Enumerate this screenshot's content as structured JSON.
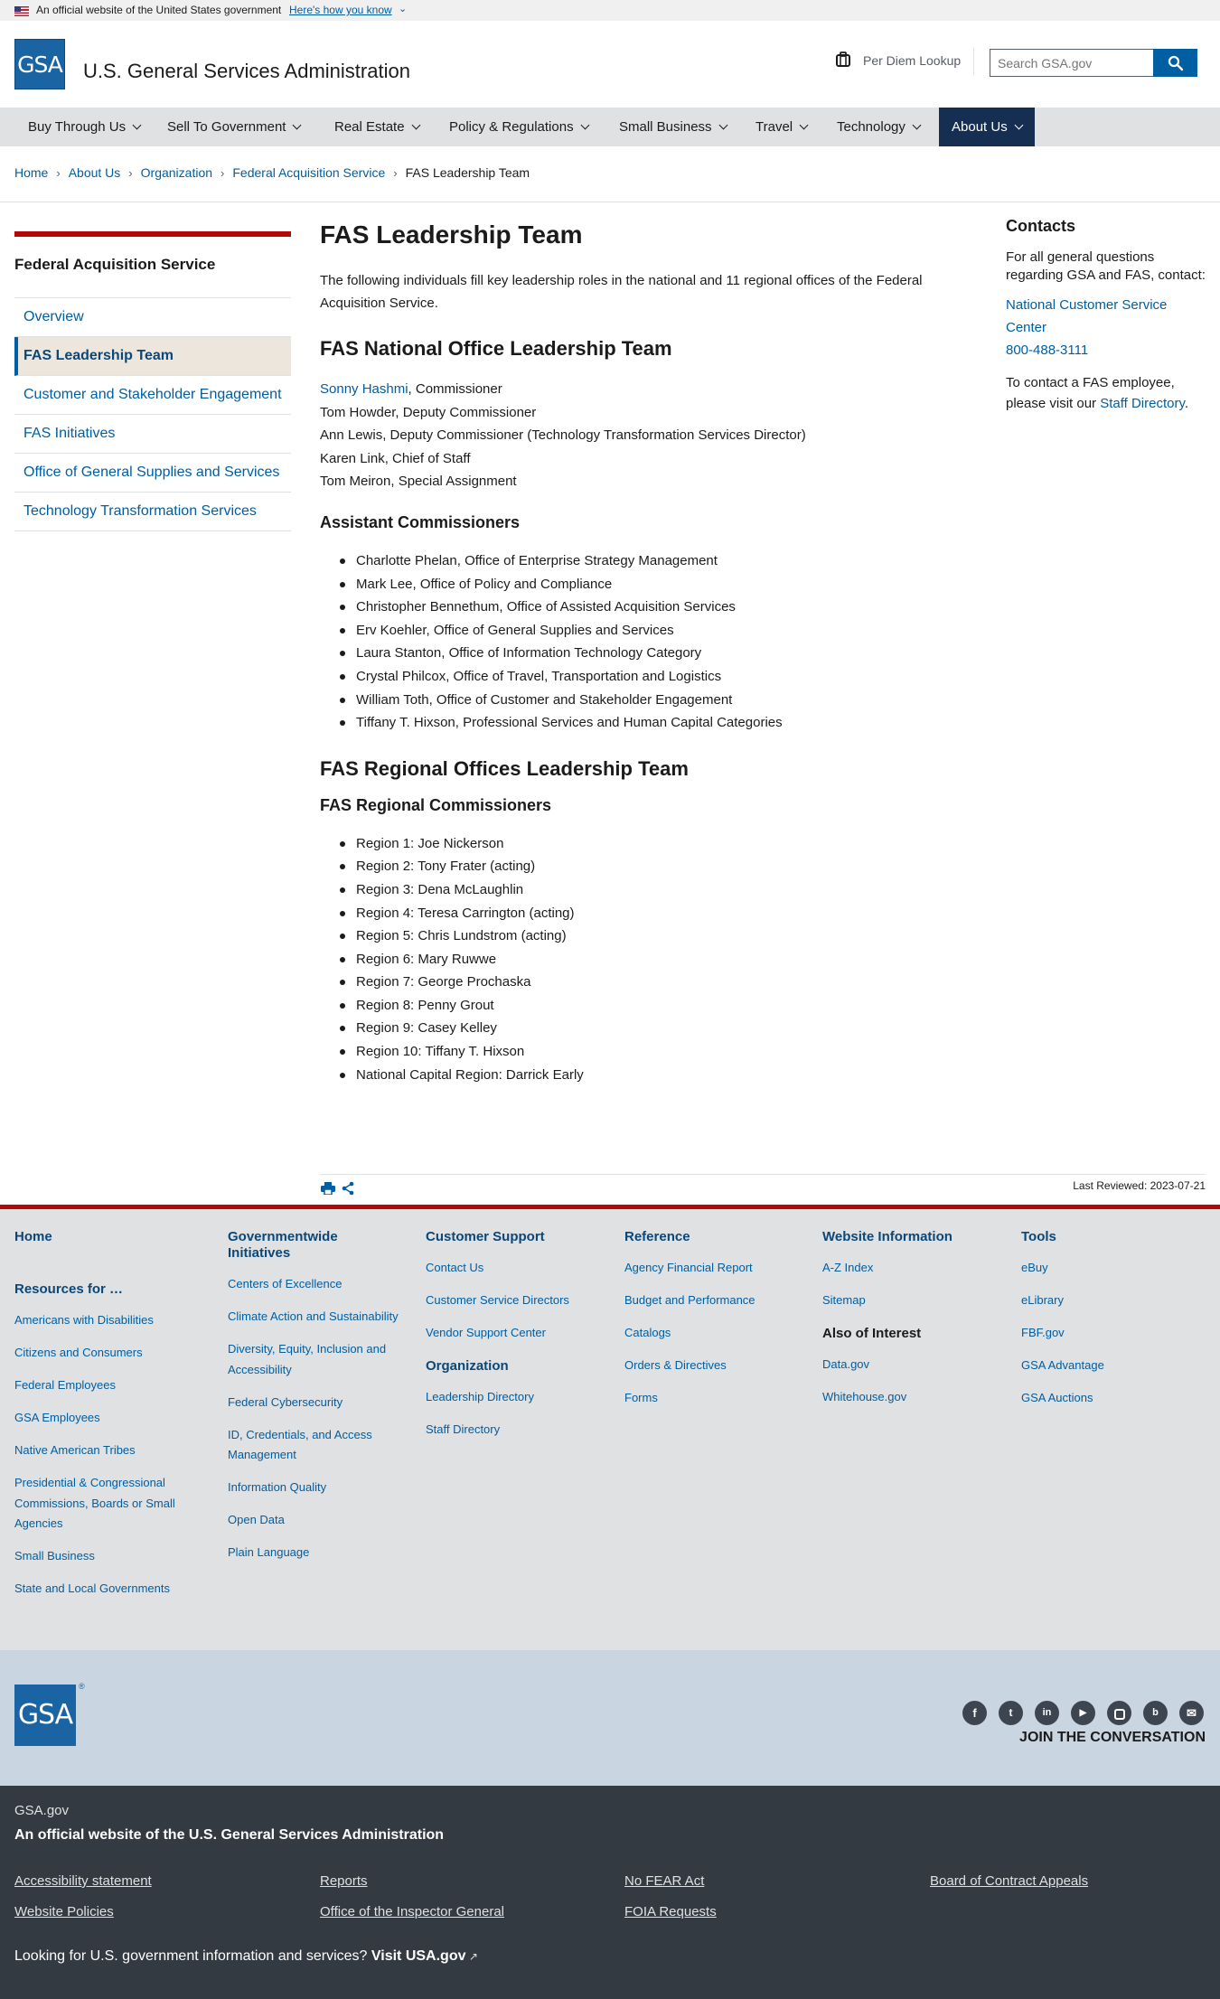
{
  "banner": {
    "official_text": "An official website of the United States government",
    "how_you_know": "Here's how you know"
  },
  "header": {
    "logo": "GSA",
    "site_title": "U.S. General Services Administration",
    "per_diem": "Per Diem Lookup",
    "search_placeholder": "Search GSA.gov"
  },
  "nav": {
    "items": [
      "Buy Through Us",
      "Sell To Government",
      "Real Estate",
      "Policy & Regulations",
      "Small Business",
      "Travel",
      "Technology",
      "About Us"
    ]
  },
  "breadcrumb": {
    "items": [
      "Home",
      "About Us",
      "Organization",
      "Federal Acquisition Service"
    ],
    "current": "FAS Leadership Team"
  },
  "sidebar": {
    "title": "Federal Acquisition Service",
    "items": [
      "Overview",
      "FAS Leadership Team",
      "Customer and Stakeholder Engagement",
      "FAS Initiatives",
      "Office of General Supplies and Services",
      "Technology Transformation Services"
    ]
  },
  "main": {
    "title": "FAS Leadership Team",
    "intro": "The following individuals fill key leadership roles in the national and 11 regional offices of the Federal Acquisition Service.",
    "national_heading": "FAS National Office Leadership Team",
    "commissioner_name": "Sonny Hashmi",
    "commissioner_role": ", Commissioner",
    "national_lines": [
      "Tom Howder, Deputy Commissioner",
      "Ann Lewis, Deputy Commissioner (Technology Transformation Services Director)",
      "Karen Link, Chief of Staff",
      "Tom Meiron, Special Assignment"
    ],
    "assistant_heading": "Assistant Commissioners",
    "assistants": [
      "Charlotte Phelan, Office of Enterprise Strategy Management",
      "Mark Lee, Office of Policy and Compliance",
      "Christopher Bennethum, Office of Assisted Acquisition Services",
      "Erv Koehler, Office of General Supplies and Services",
      "Laura Stanton, Office of Information Technology Category",
      "Crystal Philcox, Office of Travel, Transportation and Logistics",
      "William Toth, Office of Customer and Stakeholder Engagement",
      "Tiffany T. Hixson, Professional Services and Human Capital Categories"
    ],
    "regional_heading": "FAS Regional Offices Leadership Team",
    "regional_sub": "FAS Regional Commissioners",
    "regions": [
      "Region 1: Joe Nickerson",
      "Region 2: Tony Frater (acting)",
      "Region 3: Dena McLaughlin",
      "Region 4: Teresa Carrington (acting)",
      "Region 5: Chris Lundstrom (acting)",
      "Region 6: Mary Ruwwe",
      "Region 7: George Prochaska",
      "Region 8: Penny Grout",
      "Region 9: Casey Kelley",
      "Region 10: Tiffany T. Hixson",
      "National Capital Region: Darrick Early"
    ],
    "last_reviewed": "Last Reviewed: 2023-07-21"
  },
  "contacts": {
    "title": "Contacts",
    "general": "For all general questions regarding GSA and FAS, contact:",
    "ncsc": "National Customer Service Center",
    "phone": "800-488-3111",
    "employee_prefix": "To contact a FAS employee, please visit our ",
    "staff_link": "Staff Directory",
    "employee_suffix": "."
  },
  "footer": {
    "col1": {
      "home": "Home",
      "heading": "Resources for …",
      "links": [
        "Americans with Disabilities",
        "Citizens and Consumers",
        "Federal Employees",
        "GSA Employees",
        "Native American Tribes",
        "Presidential & Congressional Commissions, Boards or Small Agencies",
        "Small Business",
        "State and Local Governments"
      ]
    },
    "col2": {
      "heading": "Governmentwide Initiatives",
      "links": [
        "Centers of Excellence",
        "Climate Action and Sustainability",
        "Diversity, Equity, Inclusion and Accessibility",
        "Federal Cybersecurity",
        "ID, Credentials, and Access Management",
        "Information Quality",
        "Open Data",
        "Plain Language"
      ]
    },
    "col3": {
      "heading": "Customer Support",
      "links": [
        "Contact Us",
        "Customer Service Directors",
        "Vendor Support Center"
      ],
      "heading2": "Organization",
      "links2": [
        "Leadership Directory",
        "Staff Directory"
      ]
    },
    "col4": {
      "heading": "Reference",
      "links": [
        "Agency Financial Report",
        "Budget and Performance",
        "Catalogs",
        "Orders & Directives",
        "Forms"
      ]
    },
    "col5": {
      "heading": "Website Information",
      "links": [
        "A-Z Index",
        "Sitemap"
      ],
      "heading2": "Also of Interest",
      "links2": [
        "Data.gov",
        "Whitehouse.gov"
      ]
    },
    "col6": {
      "heading": "Tools",
      "links": [
        "eBuy",
        "eLibrary",
        "FBF.gov",
        "GSA Advantage",
        "GSA Auctions"
      ]
    },
    "logo": "GSA",
    "social_icons": [
      "facebook-icon",
      "twitter-icon",
      "linkedin-icon",
      "youtube-icon",
      "instagram-icon",
      "blog-icon",
      "email-icon"
    ],
    "join": "JOIN THE CONVERSATION",
    "domain": "GSA.gov",
    "official": "An official website of the U.S. General Services Administration",
    "identity_links": [
      "Accessibility statement",
      "Reports",
      "No FEAR Act",
      "Board of Contract Appeals",
      "Website Policies",
      "Office of the Inspector General",
      "FOIA Requests"
    ],
    "usa_prefix": "Looking for U.S. government information and services? ",
    "usa_link": "Visit USA.gov"
  },
  "colors": {
    "primary": "#005ea2",
    "accent_red": "#b50909",
    "nav_active": "#162e51",
    "sidebar_current": "#ede6dc",
    "footer_dark": "#333a42"
  }
}
